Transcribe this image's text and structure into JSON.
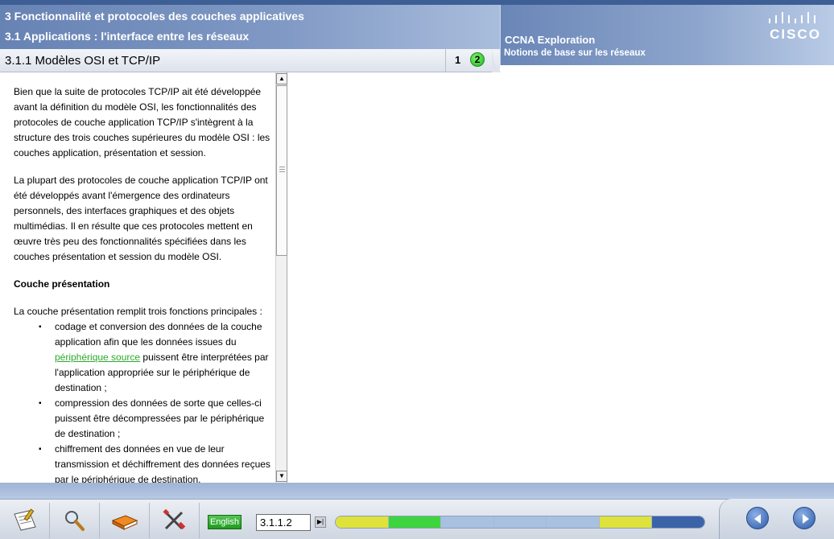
{
  "header": {
    "chapter": "3 Fonctionnalité et protocoles des couches applicatives",
    "section": "3.1 Applications : l'interface entre les réseaux",
    "course_name": "CCNA Exploration",
    "course_subtitle": "Notions de base sur les réseaux",
    "logo_text": "CISCO"
  },
  "title_bar": {
    "page_title": "3.1.1 Modèles OSI et TCP/IP",
    "pages": [
      "1",
      "2"
    ],
    "current_page": "2"
  },
  "content": {
    "para1": "Bien que la suite de protocoles TCP/IP ait été développée avant la définition du modèle OSI, les fonctionnalités des protocoles de couche application TCP/IP s'intègrent à la structure des trois couches supérieures du modèle OSI : les couches application, présentation et session.",
    "para2": "La plupart des protocoles de couche application TCP/IP ont été développés avant l'émergence des ordinateurs personnels, des interfaces graphiques et des objets multimédias. Il en résulte que ces protocoles mettent en œuvre très peu des fonctionnalités spécifiées dans les couches présentation et session du modèle OSI.",
    "heading": "Couche présentation",
    "intro": "La couche présentation remplit trois fonctions principales :",
    "bullet1_before": "codage et conversion des données de la couche application afin que les données issues du ",
    "bullet1_link": "périphérique source",
    "bullet1_after": " puissent être interprétées par l'application appropriée sur le périphérique de destination ;",
    "bullet2": "compression des données de sorte que celles-ci puissent être décompressées par le périphérique de destination ;",
    "bullet3": "chiffrement des données en vue de leur transmission et déchiffrement des données reçues par le périphérique de destination."
  },
  "footer": {
    "tools": [
      "notes-icon",
      "search-icon",
      "glossary-book-icon",
      "tools-icon"
    ],
    "language_label": "English",
    "page_number": "3.1.1.2",
    "progress_colors": [
      "#dfe23a",
      "#3ed43e",
      "#a9c1e0",
      "#a9c1e0",
      "#a9c1e0",
      "#dfe23a",
      "#3b63a8"
    ]
  }
}
